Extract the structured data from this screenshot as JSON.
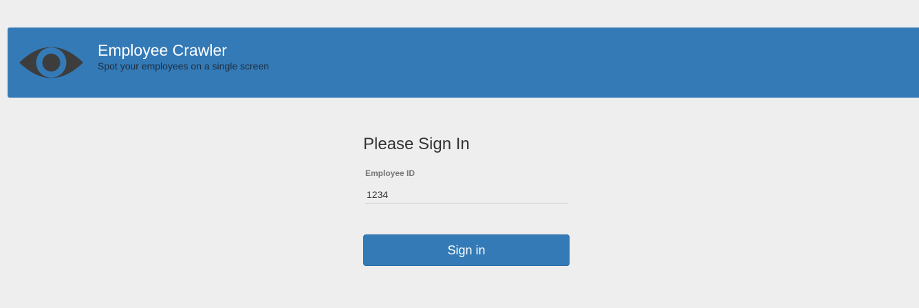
{
  "header": {
    "title": "Employee Crawler",
    "subtitle": "Spot your employees on a single screen",
    "logo_icon": "eye-icon"
  },
  "signin": {
    "title": "Please Sign In",
    "employee_id_label": "Employee ID",
    "employee_id_value": "1234",
    "button_label": "Sign in"
  },
  "colors": {
    "page_background": "#eeeeee",
    "header_background": "#337ab7",
    "button_background": "#337ab7",
    "logo_color": "#3d3d3d"
  }
}
